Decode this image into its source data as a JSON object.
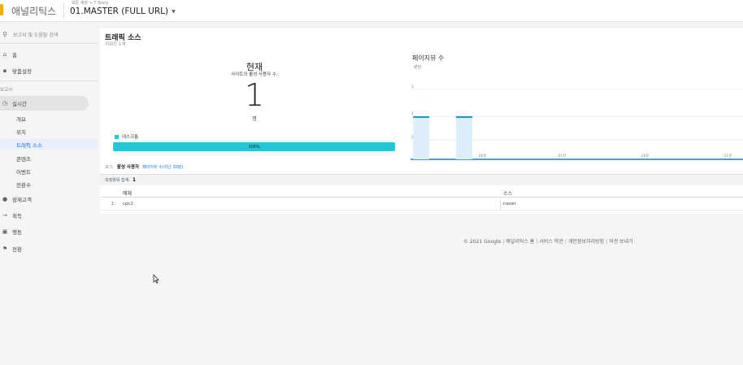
{
  "header": {
    "app_name": "애널리틱스",
    "breadcrumb": "모든 계정 > T Story",
    "view_name": "01.MASTER (FULL URL)"
  },
  "sidebar": {
    "search_placeholder": "보고서 및 도움말 검색",
    "top_items": [
      {
        "label": "홈",
        "icon": "home-icon"
      },
      {
        "label": "맞춤설정",
        "icon": "customize-icon"
      }
    ],
    "section_label": "보고서",
    "realtime": {
      "label": "실시간",
      "icon": "clock-icon"
    },
    "realtime_sub": [
      "개요",
      "위치",
      "트래픽 소스",
      "콘텐츠",
      "이벤트",
      "전환수"
    ],
    "active_sub": "트래픽 소스",
    "bottom_items": [
      {
        "label": "잠재고객",
        "icon": "person-icon"
      },
      {
        "label": "획득",
        "icon": "acquisition-icon"
      },
      {
        "label": "행동",
        "icon": "behavior-icon"
      },
      {
        "label": "전환",
        "icon": "flag-icon"
      }
    ]
  },
  "main": {
    "title": "트래픽 소스",
    "subtitle": "키워드 1개",
    "now_label": "현재",
    "now_desc": "사이트의 활성 사용자 수:",
    "now_value": "1",
    "now_unit": "명",
    "legend_label": "데스크톱",
    "bar_percent_label": "100%",
    "chart_title": "페이지뷰 수",
    "tabs": {
      "label": "보기:",
      "active": "활성 사용자",
      "inactive": "페이지뷰 수(지난 30분)"
    },
    "summary": {
      "label": "측정항목 합계:",
      "value": "1"
    },
    "table": {
      "headers": [
        "매체",
        "소스"
      ],
      "rows": [
        {
          "num": "1.",
          "medium": "cpc2",
          "source": "naver"
        }
      ]
    }
  },
  "chart_data": {
    "type": "bar",
    "title": "페이지뷰 수",
    "subtitle": "분당",
    "y_ticks": [
      "2",
      "1",
      "1"
    ],
    "x_ticks": [
      "-26분",
      "-21분",
      "-16분",
      "-11분"
    ],
    "values": [
      {
        "x": -30,
        "y": 1
      },
      {
        "x": -26,
        "y": 1
      }
    ],
    "colors": {
      "bar": "#2196c8",
      "bar_fill": "#dceefa",
      "axis": "#1a73e8"
    }
  },
  "footer": {
    "copyright": "© 2021 Google",
    "links": [
      "애널리틱스 홈",
      "서비스 약관",
      "개인정보처리방침",
      "의견 보내기"
    ]
  },
  "colors": {
    "accent": "#26c6da",
    "active_nav_bg": "#e8f0fe",
    "logo": "#f9ab00"
  }
}
